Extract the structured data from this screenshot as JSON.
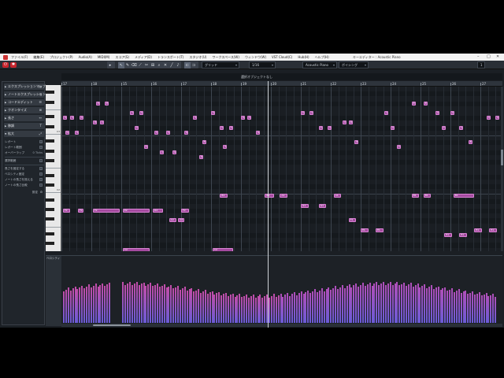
{
  "window": {
    "title": "キーエディター : Acoustic Piano"
  },
  "menu": [
    "ファイル(F)",
    "編集(E)",
    "プロジェクト(P)",
    "Audio(A)",
    "MIDI(M)",
    "スコア(S)",
    "メディア(D)",
    "トランスポート(T)",
    "スタジオ(U)",
    "ワークスペース(W)",
    "ウィンドウ(W)",
    "VST Cloud(C)",
    "Hub(H)",
    "ヘルプ(H)"
  ],
  "toolbar": {
    "grid_type": "グリッド",
    "quantize": "1/16",
    "instrument": "Acoustic Piano",
    "chord_mode": "ボイシング",
    "zoom_value": "1",
    "colors": {
      "accent_red": "#c8242c",
      "note_fill": "#a54aa0",
      "note_border": "#d883d3"
    }
  },
  "chord_track": {
    "label": "選択オブジェクトなし"
  },
  "inspector": {
    "sections": [
      {
        "label": "エクスプレッションマップ",
        "icon": "map-icon"
      },
      {
        "label": "ノートエクスプレッション",
        "icon": "expression-icon"
      },
      {
        "label": "コードエディット",
        "icon": "chord-edit-icon"
      },
      {
        "label": "クオンタイズ",
        "icon": "quantize-icon"
      },
      {
        "label": "長さ",
        "icon": "length-icon"
      },
      {
        "label": "移調",
        "icon": "transpose-icon"
      },
      {
        "label": "拡大",
        "icon": "expand-icon"
      }
    ],
    "rows": [
      {
        "label": "レガート",
        "value": ""
      },
      {
        "label": "レガート範囲",
        "value": ""
      },
      {
        "label": "オーバーラップ",
        "value": "0 Ticks"
      },
      {
        "label": "選択範囲",
        "value": ""
      },
      {
        "label": "長さを固定する",
        "value": ""
      },
      {
        "label": "ベロシティ固定",
        "value": ""
      },
      {
        "label": "ノートの長さを揃える",
        "value": ""
      },
      {
        "label": "ノートの長さ比較",
        "value": ""
      }
    ],
    "footer_label": "設定"
  },
  "ruler": {
    "bars": [
      "17",
      "18",
      "15",
      "16",
      "17",
      "18",
      "19",
      "20",
      "21",
      "22",
      "23",
      "24",
      "25",
      "26",
      "27"
    ]
  },
  "keyboard": {
    "c_labels": [
      "C3",
      "C2"
    ]
  },
  "controller_lane": {
    "label": "ベロシティ"
  },
  "notes": [
    {
      "label": "A3"
    },
    {
      "label": "G3"
    },
    {
      "label": "E3"
    },
    {
      "label": "D3"
    },
    {
      "label": "C3"
    },
    {
      "label": "C3"
    },
    {
      "label": "A2"
    },
    {
      "label": "G2"
    },
    {
      "label": "F2"
    },
    {
      "label": "E2"
    },
    {
      "label": "D2"
    },
    {
      "label": "C2"
    },
    {
      "label": "B1"
    },
    {
      "label": "A1"
    },
    {
      "label": "G1"
    },
    {
      "label": "F1"
    },
    {
      "label": "E1"
    }
  ]
}
